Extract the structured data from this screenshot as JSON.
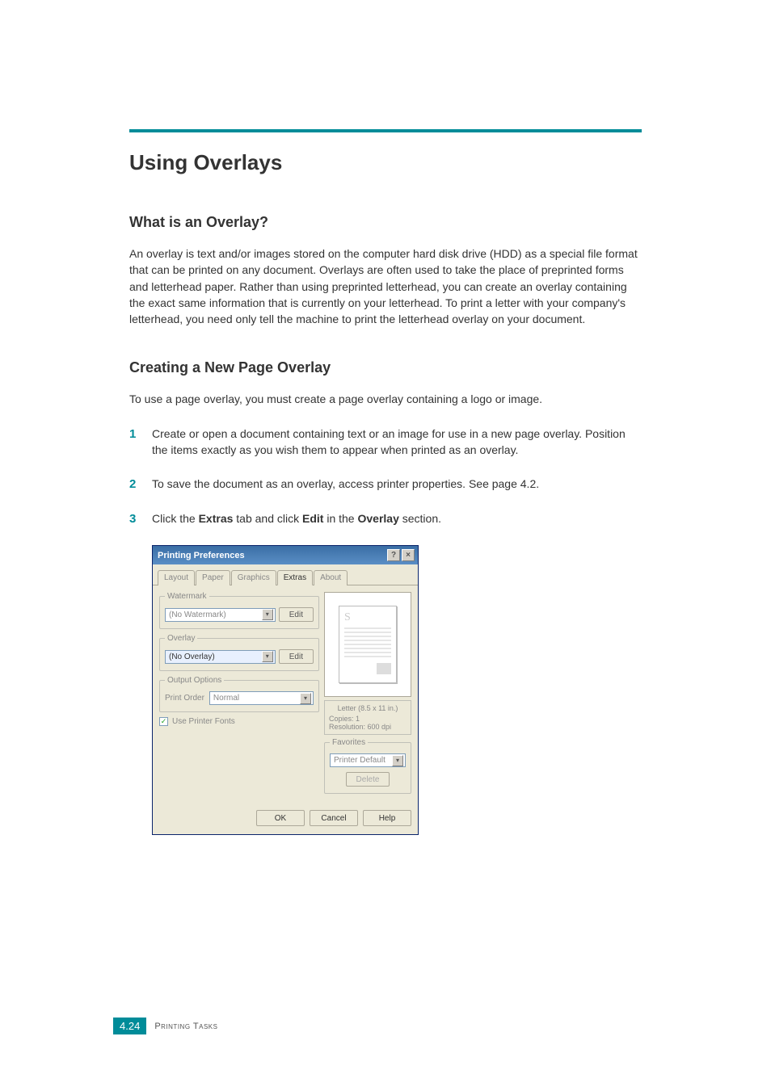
{
  "page": {
    "main_heading": "Using Overlays",
    "section1_heading": "What is an Overlay?",
    "section1_body": "An overlay is text and/or images stored on the computer hard disk drive (HDD) as a special file format that can be printed on any document. Overlays are often used to take the place of preprinted forms and letterhead paper. Rather than using preprinted letterhead, you can create an overlay containing the exact same information that is currently on your letterhead. To print a letter with your company's letterhead, you need only tell the machine to print the letterhead overlay on your document.",
    "section2_heading": "Creating a New Page Overlay",
    "section2_intro": "To use a page overlay, you must create a page overlay containing a logo or image.",
    "step1_num": "1",
    "step1_text": "Create or open a document containing text or an image for use in a new page overlay. Position the items exactly as you wish them to appear when printed as an overlay.",
    "step2_num": "2",
    "step2_text": "To save the document as an overlay, access printer properties. See page 4.2.",
    "step3_num": "3",
    "step3_pre": "Click the ",
    "step3_b1": "Extras",
    "step3_mid": " tab and click ",
    "step3_b2": "Edit",
    "step3_mid2": " in the ",
    "step3_b3": "Overlay",
    "step3_post": " section."
  },
  "dialog": {
    "title": "Printing Preferences",
    "help_glyph": "?",
    "close_glyph": "×",
    "tabs": {
      "layout": "Layout",
      "paper": "Paper",
      "graphics": "Graphics",
      "extras": "Extras",
      "about": "About"
    },
    "watermark": {
      "legend": "Watermark",
      "value": "(No Watermark)",
      "edit": "Edit"
    },
    "overlay": {
      "legend": "Overlay",
      "value": "(No Overlay)",
      "edit": "Edit"
    },
    "output": {
      "legend": "Output Options",
      "label": "Print Order",
      "value": "Normal"
    },
    "use_printer_fonts": "Use Printer Fonts",
    "preview": {
      "letter_s": "S",
      "paper_size": "Letter (8.5 x 11 in.)",
      "copies": "Copies: 1",
      "resolution": "Resolution: 600 dpi"
    },
    "favorites": {
      "legend": "Favorites",
      "value": "Printer Default",
      "delete": "Delete"
    },
    "buttons": {
      "ok": "OK",
      "cancel": "Cancel",
      "help": "Help"
    }
  },
  "footer": {
    "page_num": "4.24",
    "label": "Printing Tasks"
  }
}
